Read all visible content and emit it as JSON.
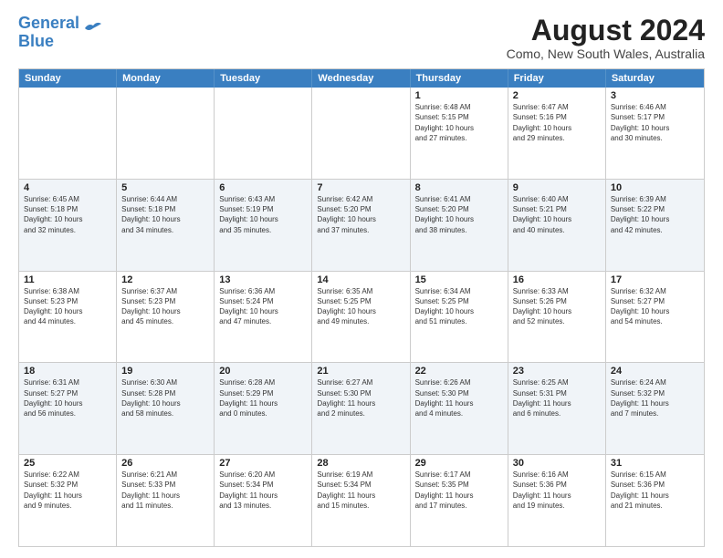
{
  "header": {
    "logo_line1": "General",
    "logo_line2": "Blue",
    "title": "August 2024",
    "subtitle": "Como, New South Wales, Australia"
  },
  "weekdays": [
    "Sunday",
    "Monday",
    "Tuesday",
    "Wednesday",
    "Thursday",
    "Friday",
    "Saturday"
  ],
  "rows": [
    [
      {
        "day": "",
        "info": ""
      },
      {
        "day": "",
        "info": ""
      },
      {
        "day": "",
        "info": ""
      },
      {
        "day": "",
        "info": ""
      },
      {
        "day": "1",
        "info": "Sunrise: 6:48 AM\nSunset: 5:15 PM\nDaylight: 10 hours\nand 27 minutes."
      },
      {
        "day": "2",
        "info": "Sunrise: 6:47 AM\nSunset: 5:16 PM\nDaylight: 10 hours\nand 29 minutes."
      },
      {
        "day": "3",
        "info": "Sunrise: 6:46 AM\nSunset: 5:17 PM\nDaylight: 10 hours\nand 30 minutes."
      }
    ],
    [
      {
        "day": "4",
        "info": "Sunrise: 6:45 AM\nSunset: 5:18 PM\nDaylight: 10 hours\nand 32 minutes."
      },
      {
        "day": "5",
        "info": "Sunrise: 6:44 AM\nSunset: 5:18 PM\nDaylight: 10 hours\nand 34 minutes."
      },
      {
        "day": "6",
        "info": "Sunrise: 6:43 AM\nSunset: 5:19 PM\nDaylight: 10 hours\nand 35 minutes."
      },
      {
        "day": "7",
        "info": "Sunrise: 6:42 AM\nSunset: 5:20 PM\nDaylight: 10 hours\nand 37 minutes."
      },
      {
        "day": "8",
        "info": "Sunrise: 6:41 AM\nSunset: 5:20 PM\nDaylight: 10 hours\nand 38 minutes."
      },
      {
        "day": "9",
        "info": "Sunrise: 6:40 AM\nSunset: 5:21 PM\nDaylight: 10 hours\nand 40 minutes."
      },
      {
        "day": "10",
        "info": "Sunrise: 6:39 AM\nSunset: 5:22 PM\nDaylight: 10 hours\nand 42 minutes."
      }
    ],
    [
      {
        "day": "11",
        "info": "Sunrise: 6:38 AM\nSunset: 5:23 PM\nDaylight: 10 hours\nand 44 minutes."
      },
      {
        "day": "12",
        "info": "Sunrise: 6:37 AM\nSunset: 5:23 PM\nDaylight: 10 hours\nand 45 minutes."
      },
      {
        "day": "13",
        "info": "Sunrise: 6:36 AM\nSunset: 5:24 PM\nDaylight: 10 hours\nand 47 minutes."
      },
      {
        "day": "14",
        "info": "Sunrise: 6:35 AM\nSunset: 5:25 PM\nDaylight: 10 hours\nand 49 minutes."
      },
      {
        "day": "15",
        "info": "Sunrise: 6:34 AM\nSunset: 5:25 PM\nDaylight: 10 hours\nand 51 minutes."
      },
      {
        "day": "16",
        "info": "Sunrise: 6:33 AM\nSunset: 5:26 PM\nDaylight: 10 hours\nand 52 minutes."
      },
      {
        "day": "17",
        "info": "Sunrise: 6:32 AM\nSunset: 5:27 PM\nDaylight: 10 hours\nand 54 minutes."
      }
    ],
    [
      {
        "day": "18",
        "info": "Sunrise: 6:31 AM\nSunset: 5:27 PM\nDaylight: 10 hours\nand 56 minutes."
      },
      {
        "day": "19",
        "info": "Sunrise: 6:30 AM\nSunset: 5:28 PM\nDaylight: 10 hours\nand 58 minutes."
      },
      {
        "day": "20",
        "info": "Sunrise: 6:28 AM\nSunset: 5:29 PM\nDaylight: 11 hours\nand 0 minutes."
      },
      {
        "day": "21",
        "info": "Sunrise: 6:27 AM\nSunset: 5:30 PM\nDaylight: 11 hours\nand 2 minutes."
      },
      {
        "day": "22",
        "info": "Sunrise: 6:26 AM\nSunset: 5:30 PM\nDaylight: 11 hours\nand 4 minutes."
      },
      {
        "day": "23",
        "info": "Sunrise: 6:25 AM\nSunset: 5:31 PM\nDaylight: 11 hours\nand 6 minutes."
      },
      {
        "day": "24",
        "info": "Sunrise: 6:24 AM\nSunset: 5:32 PM\nDaylight: 11 hours\nand 7 minutes."
      }
    ],
    [
      {
        "day": "25",
        "info": "Sunrise: 6:22 AM\nSunset: 5:32 PM\nDaylight: 11 hours\nand 9 minutes."
      },
      {
        "day": "26",
        "info": "Sunrise: 6:21 AM\nSunset: 5:33 PM\nDaylight: 11 hours\nand 11 minutes."
      },
      {
        "day": "27",
        "info": "Sunrise: 6:20 AM\nSunset: 5:34 PM\nDaylight: 11 hours\nand 13 minutes."
      },
      {
        "day": "28",
        "info": "Sunrise: 6:19 AM\nSunset: 5:34 PM\nDaylight: 11 hours\nand 15 minutes."
      },
      {
        "day": "29",
        "info": "Sunrise: 6:17 AM\nSunset: 5:35 PM\nDaylight: 11 hours\nand 17 minutes."
      },
      {
        "day": "30",
        "info": "Sunrise: 6:16 AM\nSunset: 5:36 PM\nDaylight: 11 hours\nand 19 minutes."
      },
      {
        "day": "31",
        "info": "Sunrise: 6:15 AM\nSunset: 5:36 PM\nDaylight: 11 hours\nand 21 minutes."
      }
    ]
  ]
}
